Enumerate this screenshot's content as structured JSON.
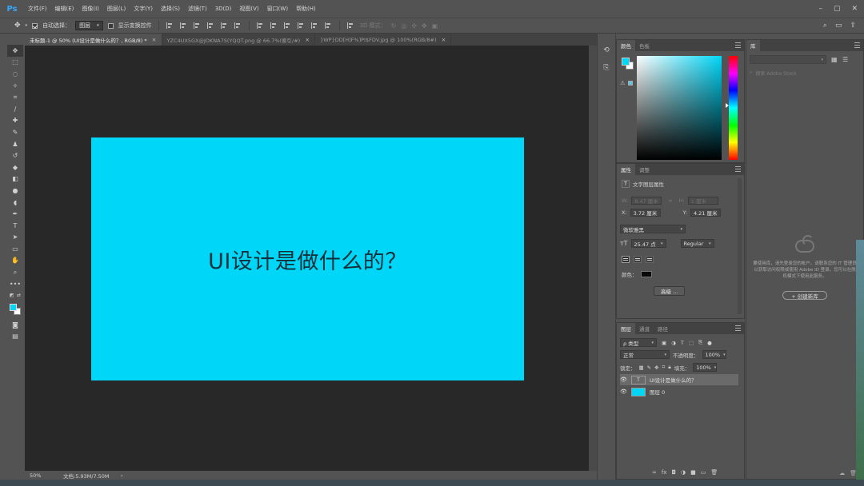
{
  "app": {
    "logo": "Ps"
  },
  "menu": [
    "文件(F)",
    "编辑(E)",
    "图像(I)",
    "图层(L)",
    "文字(Y)",
    "选择(S)",
    "滤镜(T)",
    "3D(D)",
    "视图(V)",
    "窗口(W)",
    "帮助(H)"
  ],
  "window_controls": {
    "minimize": "–",
    "restore": "▢",
    "close": "✕"
  },
  "options": {
    "auto_select_label": "自动选择：",
    "auto_select_value": "图层",
    "show_transform_label": "显示变换控件",
    "mode_3d_label": "3D 模式："
  },
  "tabs": [
    {
      "label": "未标题-1 @ 50% (UI设计是做什么的？, RGB/8) *",
      "close": "×"
    },
    {
      "label": "YZC4UX5GX@JOKNA7S(YQQT.png @ 66.7%(索引/#)",
      "close": "×"
    },
    {
      "label": "}WP}DD[H]F%]PI$FDV.jpg @ 100%(RGB/8#)",
      "close": "×"
    }
  ],
  "document": {
    "text": "UI设计是做什么的？",
    "background": "#00d6f7"
  },
  "status": {
    "zoom": "50%",
    "doc_size": "文档:5.93M/7.50M",
    "arrow": "›"
  },
  "color_panel": {
    "tabs": [
      "颜色",
      "色板"
    ],
    "fg": "#00d6f7",
    "bg": "#ffffff"
  },
  "properties": {
    "tabs": [
      "属性",
      "调整"
    ],
    "title": "文字图层属性",
    "w_label": "W:",
    "w_value": "8.47 厘米",
    "h_label": "H:",
    "h_value": "1 厘米",
    "x_label": "X:",
    "x_value": "3.72 厘米",
    "y_label": "Y:",
    "y_value": "4.21 厘米",
    "font_family": "微软雅黑",
    "font_size": "25.47 点",
    "font_style": "Regular",
    "color_label": "颜色：",
    "color_value": "#0a0a0a",
    "advanced_button": "高级 ..."
  },
  "layers": {
    "tabs": [
      "图层",
      "通道",
      "路径"
    ],
    "filter_label": "ρ 类型",
    "blend_mode": "正常",
    "opacity_label": "不透明度：",
    "opacity_value": "100%",
    "lock_label": "锁定：",
    "fill_label": "填充：",
    "fill_value": "100%",
    "items": [
      {
        "name": "UI设计是做什么的？",
        "thumb": "T"
      },
      {
        "name": "图层 0",
        "thumb": ""
      }
    ],
    "bottom_icons": [
      "∞",
      "fx",
      "◘",
      "◑",
      "■",
      "▭",
      "🗑"
    ]
  },
  "library": {
    "tab": "库",
    "search_placeholder": "搜索 Adobe Stock",
    "message": "要使用库，请先登录您的帐户。请联系您的 IT 管理员以获取访问权限或使用 Adobe ID 登录。您可以在脱机模式下使用此服务。",
    "create_button": "+ 创建新库"
  }
}
